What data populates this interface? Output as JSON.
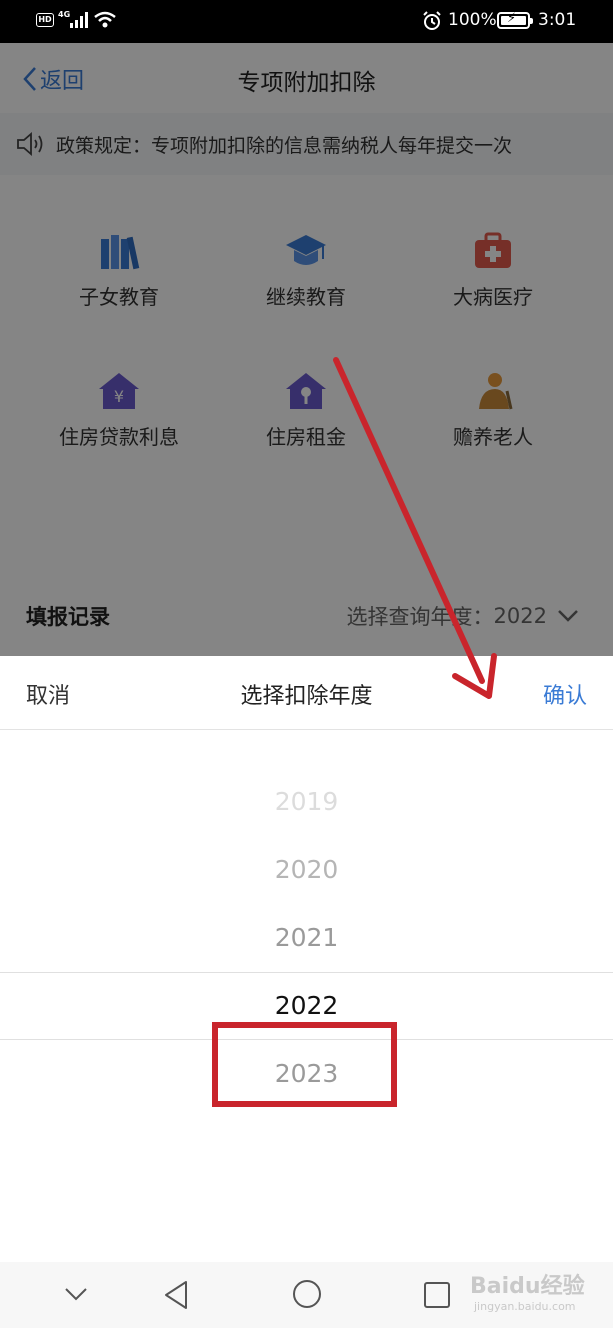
{
  "status_bar": {
    "hd": "HD",
    "network": "4G",
    "battery": "100%",
    "time": "3:01"
  },
  "nav": {
    "back_label": "返回",
    "title": "专项附加扣除"
  },
  "notice": "政策规定：专项附加扣除的信息需纳税人每年提交一次",
  "categories": [
    {
      "label": "子女教育",
      "icon": "books-icon",
      "color": "#3a7bd5"
    },
    {
      "label": "继续教育",
      "icon": "graduation-cap-icon",
      "color": "#3a7bd5"
    },
    {
      "label": "大病医疗",
      "icon": "medical-kit-icon",
      "color": "#e35a4e"
    },
    {
      "label": "住房贷款利息",
      "icon": "house-yuan-icon",
      "color": "#6a5acd"
    },
    {
      "label": "住房租金",
      "icon": "house-key-icon",
      "color": "#6a5acd"
    },
    {
      "label": "赡养老人",
      "icon": "elderly-person-icon",
      "color": "#e89a3c"
    }
  ],
  "records": {
    "title": "填报记录",
    "year_label": "选择查询年度：",
    "year_value": "2022"
  },
  "picker": {
    "cancel": "取消",
    "title": "选择扣除年度",
    "confirm": "确认",
    "years": [
      {
        "label": "2019",
        "color": "#dcdcdc"
      },
      {
        "label": "2020",
        "color": "#b5b5b5"
      },
      {
        "label": "2021",
        "color": "#9a9a9a"
      },
      {
        "label": "2022",
        "color": "#111111"
      },
      {
        "label": "2023",
        "color": "#9a9a9a"
      }
    ],
    "selected": "2022"
  },
  "watermark": {
    "brand": "Baidu经验",
    "site": "jingyan.baidu.com"
  },
  "colors": {
    "accent": "#3a7bd5",
    "annotation": "#c9252c"
  }
}
